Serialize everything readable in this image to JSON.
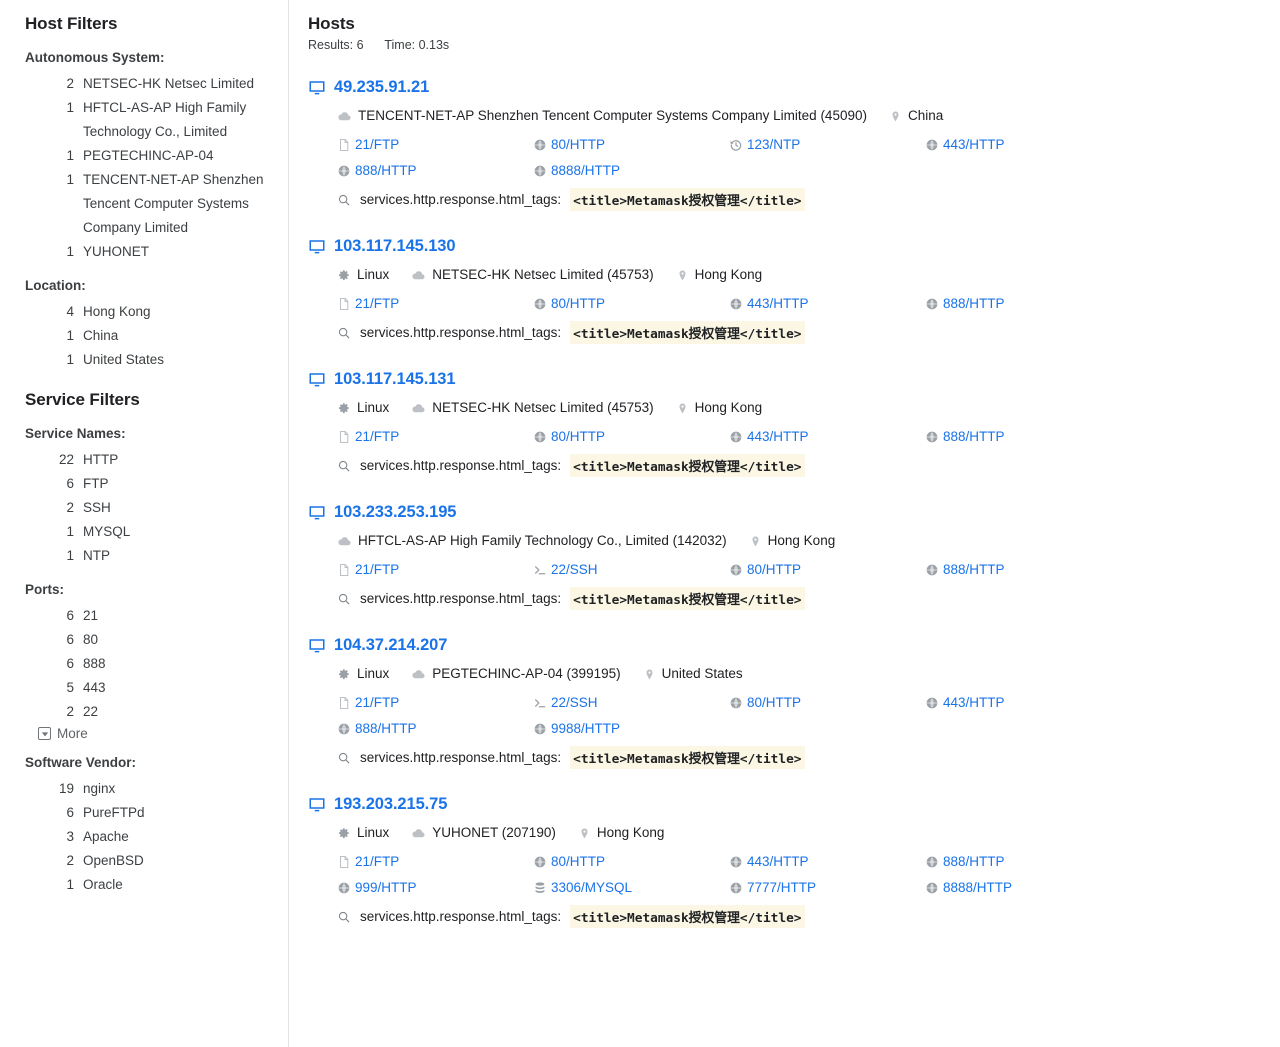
{
  "sidebar": {
    "host_filters_title": "Host Filters",
    "service_filters_title": "Service Filters",
    "more_label": "More",
    "facets": [
      {
        "label": "Autonomous System:",
        "items": [
          {
            "count": "2",
            "name": "NETSEC-HK Netsec Limited"
          },
          {
            "count": "1",
            "name": "HFTCL-AS-AP High Family Technology Co., Limited"
          },
          {
            "count": "1",
            "name": "PEGTECHINC-AP-04"
          },
          {
            "count": "1",
            "name": "TENCENT-NET-AP Shenzhen Tencent Computer Systems Company Limited"
          },
          {
            "count": "1",
            "name": "YUHONET"
          }
        ]
      },
      {
        "label": "Location:",
        "items": [
          {
            "count": "4",
            "name": "Hong Kong"
          },
          {
            "count": "1",
            "name": "China"
          },
          {
            "count": "1",
            "name": "United States"
          }
        ]
      }
    ],
    "service_facets": [
      {
        "label": "Service Names:",
        "items": [
          {
            "count": "22",
            "name": "HTTP"
          },
          {
            "count": "6",
            "name": "FTP"
          },
          {
            "count": "2",
            "name": "SSH"
          },
          {
            "count": "1",
            "name": "MYSQL"
          },
          {
            "count": "1",
            "name": "NTP"
          }
        ]
      },
      {
        "label": "Ports:",
        "has_more": true,
        "items": [
          {
            "count": "6",
            "name": "21"
          },
          {
            "count": "6",
            "name": "80"
          },
          {
            "count": "6",
            "name": "888"
          },
          {
            "count": "5",
            "name": "443"
          },
          {
            "count": "2",
            "name": "22"
          }
        ]
      },
      {
        "label": "Software Vendor:",
        "items": [
          {
            "count": "19",
            "name": "nginx"
          },
          {
            "count": "6",
            "name": "PureFTPd"
          },
          {
            "count": "3",
            "name": "Apache"
          },
          {
            "count": "2",
            "name": "OpenBSD"
          },
          {
            "count": "1",
            "name": "Oracle"
          }
        ]
      }
    ]
  },
  "main": {
    "title": "Hosts",
    "results_label": "Results: 6",
    "time_label": "Time: 0.13s",
    "match_field_label": "services.http.response.html_tags:",
    "hosts": [
      {
        "ip": "49.235.91.21",
        "os": null,
        "asn": "TENCENT-NET-AP Shenzhen Tencent Computer Systems Company Limited (45090)",
        "location": "China",
        "ports": [
          {
            "label": "21/FTP",
            "icon": "file-icon"
          },
          {
            "label": "80/HTTP",
            "icon": "globe-icon"
          },
          {
            "label": "123/NTP",
            "icon": "history-icon"
          },
          {
            "label": "443/HTTP",
            "icon": "globe-icon"
          },
          {
            "label": "888/HTTP",
            "icon": "globe-icon"
          },
          {
            "label": "8888/HTTP",
            "icon": "globe-icon"
          }
        ],
        "match_value": "<title>Metamask授权管理</title>"
      },
      {
        "ip": "103.117.145.130",
        "os": "Linux",
        "asn": "NETSEC-HK Netsec Limited (45753)",
        "location": "Hong Kong",
        "ports": [
          {
            "label": "21/FTP",
            "icon": "file-icon"
          },
          {
            "label": "80/HTTP",
            "icon": "globe-icon"
          },
          {
            "label": "443/HTTP",
            "icon": "globe-icon"
          },
          {
            "label": "888/HTTP",
            "icon": "globe-icon"
          }
        ],
        "match_value": "<title>Metamask授权管理</title>"
      },
      {
        "ip": "103.117.145.131",
        "os": "Linux",
        "asn": "NETSEC-HK Netsec Limited (45753)",
        "location": "Hong Kong",
        "ports": [
          {
            "label": "21/FTP",
            "icon": "file-icon"
          },
          {
            "label": "80/HTTP",
            "icon": "globe-icon"
          },
          {
            "label": "443/HTTP",
            "icon": "globe-icon"
          },
          {
            "label": "888/HTTP",
            "icon": "globe-icon"
          }
        ],
        "match_value": "<title>Metamask授权管理</title>"
      },
      {
        "ip": "103.233.253.195",
        "os": null,
        "asn": "HFTCL-AS-AP High Family Technology Co., Limited (142032)",
        "location": "Hong Kong",
        "ports": [
          {
            "label": "21/FTP",
            "icon": "file-icon"
          },
          {
            "label": "22/SSH",
            "icon": "terminal-icon"
          },
          {
            "label": "80/HTTP",
            "icon": "globe-icon"
          },
          {
            "label": "888/HTTP",
            "icon": "globe-icon"
          }
        ],
        "match_value": "<title>Metamask授权管理</title>"
      },
      {
        "ip": "104.37.214.207",
        "os": "Linux",
        "asn": "PEGTECHINC-AP-04 (399195)",
        "location": "United States",
        "ports": [
          {
            "label": "21/FTP",
            "icon": "file-icon"
          },
          {
            "label": "22/SSH",
            "icon": "terminal-icon"
          },
          {
            "label": "80/HTTP",
            "icon": "globe-icon"
          },
          {
            "label": "443/HTTP",
            "icon": "globe-icon"
          },
          {
            "label": "888/HTTP",
            "icon": "globe-icon"
          },
          {
            "label": "9988/HTTP",
            "icon": "globe-icon"
          }
        ],
        "match_value": "<title>Metamask授权管理</title>"
      },
      {
        "ip": "193.203.215.75",
        "os": "Linux",
        "asn": "YUHONET (207190)",
        "location": "Hong Kong",
        "ports": [
          {
            "label": "21/FTP",
            "icon": "file-icon"
          },
          {
            "label": "80/HTTP",
            "icon": "globe-icon"
          },
          {
            "label": "443/HTTP",
            "icon": "globe-icon"
          },
          {
            "label": "888/HTTP",
            "icon": "globe-icon"
          },
          {
            "label": "999/HTTP",
            "icon": "globe-icon"
          },
          {
            "label": "3306/MYSQL",
            "icon": "database-icon"
          },
          {
            "label": "7777/HTTP",
            "icon": "globe-icon"
          },
          {
            "label": "8888/HTTP",
            "icon": "globe-icon"
          }
        ],
        "match_value": "<title>Metamask授权管理</title>"
      }
    ]
  },
  "colors": {
    "link": "#1a73e8",
    "text": "#202124",
    "muted": "#5f6368",
    "icon_grey": "#bdc1c6",
    "highlight": "#fbf7e4",
    "border": "#e3e4e8"
  }
}
